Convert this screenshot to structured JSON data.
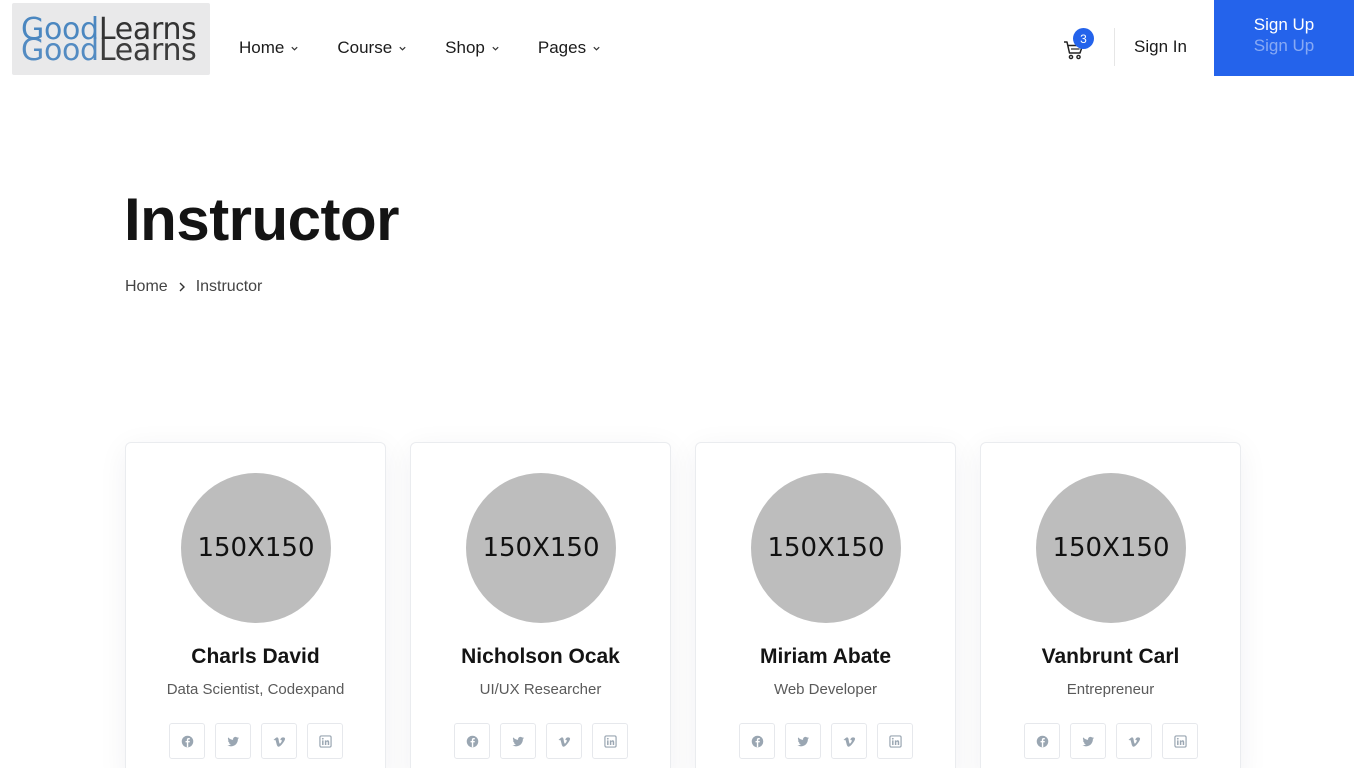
{
  "brand": {
    "logo_part1": "Good",
    "logo_part2": "Learns"
  },
  "nav": {
    "items": [
      {
        "label": "Home"
      },
      {
        "label": "Course"
      },
      {
        "label": "Shop"
      },
      {
        "label": "Pages"
      }
    ]
  },
  "header": {
    "cart_count": "3",
    "sign_in_label": "Sign In",
    "sign_up_label": "Sign Up"
  },
  "page": {
    "title": "Instructor",
    "breadcrumb": {
      "home": "Home",
      "current": "Instructor"
    }
  },
  "instructors": [
    {
      "avatar_placeholder": "150X150",
      "name": "Charls David",
      "role": "Data Scientist, Codexpand"
    },
    {
      "avatar_placeholder": "150X150",
      "name": "Nicholson Ocak",
      "role": "UI/UX Researcher"
    },
    {
      "avatar_placeholder": "150X150",
      "name": "Miriam Abate",
      "role": "Web Developer"
    },
    {
      "avatar_placeholder": "150X150",
      "name": "Vanbrunt Carl",
      "role": "Entrepreneur"
    }
  ],
  "social_icons": [
    "facebook-icon",
    "twitter-icon",
    "vimeo-icon",
    "linkedin-icon"
  ],
  "colors": {
    "accent": "#2463eb",
    "avatar_placeholder": "#bdbdbd",
    "icon_muted": "#9aa6b2"
  }
}
